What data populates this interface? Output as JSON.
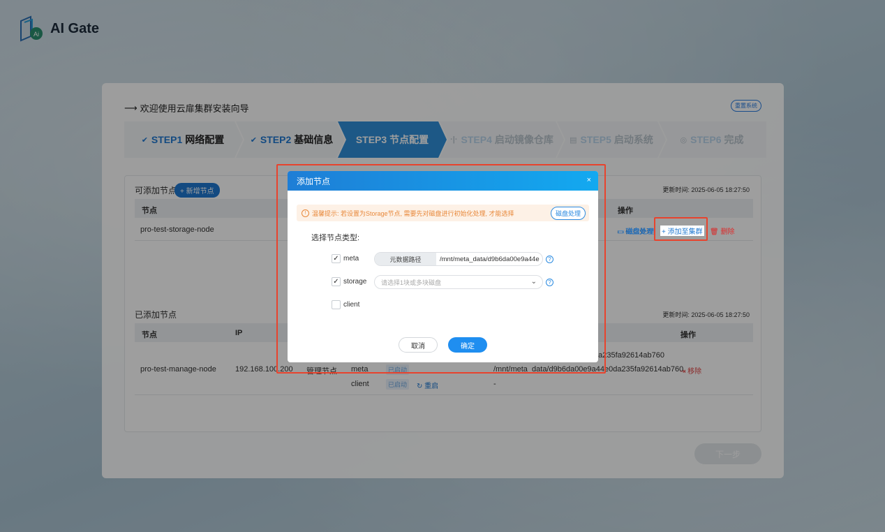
{
  "app": {
    "brand": "AI Gate"
  },
  "wizard": {
    "title": "欢迎使用云扉集群安装向导",
    "reset": "重置系统",
    "steps": [
      {
        "num": "STEP1",
        "label": "网络配置",
        "state": "done"
      },
      {
        "num": "STEP2",
        "label": "基础信息",
        "state": "done"
      },
      {
        "num": "STEP3",
        "label": "节点配置",
        "state": "active"
      },
      {
        "num": "STEP4",
        "label": "启动镜像仓库",
        "state": "pending"
      },
      {
        "num": "STEP5",
        "label": "启动系统",
        "state": "pending"
      },
      {
        "num": "STEP6",
        "label": "完成",
        "state": "pending"
      }
    ],
    "next": "下一步"
  },
  "available": {
    "title": "可添加节点",
    "add_btn": "+ 新增节点",
    "updated": "更新时间: 2025-06-05 18:27:50",
    "col_node": "节点",
    "col_op": "操作",
    "row_node": "pro-test-storage-node",
    "op_disk": "磁盘处理",
    "op_add": "添加至集群",
    "op_delete": "删除"
  },
  "added": {
    "title": "已添加节点",
    "updated": "更新时间: 2025-06-05 18:27:50",
    "col_node": "节点",
    "col_ip": "IP",
    "col_op": "操作",
    "node": "pro-test-manage-node",
    "ip": "192.168.100.200",
    "role": "管理节点",
    "svc_meta": "meta",
    "svc_client": "client",
    "status_started": "已启动",
    "restart": "重启",
    "path1": "da235fa92614ab760",
    "path2": "/mnt/meta_data/d9b6da00e9a44e0da235fa92614ab760",
    "dash": "-",
    "remove": "移除"
  },
  "modal": {
    "title": "添加节点",
    "close": "×",
    "tip": "温馨提示: 若设置为Storage节点, 需要先对磁盘进行初始化处理, 才能选择",
    "tip_btn": "磁盘处理",
    "type_label": "选择节点类型:",
    "meta": "meta",
    "storage": "storage",
    "client": "client",
    "meta_prefix": "元数据路径",
    "meta_path": "/mnt/meta_data/d9b6da00e9a44e",
    "storage_placeholder": "请选择1块或多块磁盘",
    "cancel": "取消",
    "ok": "确定"
  }
}
